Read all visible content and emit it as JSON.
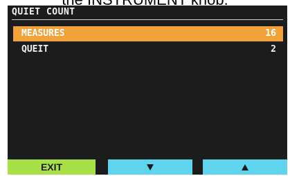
{
  "caption": "the INSTRUMENT knob.",
  "screen": {
    "title": "QUIET COUNT",
    "items": [
      {
        "label": "MEASURES",
        "value": "16",
        "selected": true
      },
      {
        "label": "QUEIT",
        "value": "2",
        "selected": false
      }
    ]
  },
  "softkeys": {
    "exit_label": "EXIT",
    "down_icon": "down-triangle-icon",
    "up_icon": "up-triangle-icon"
  },
  "colors": {
    "screen_background": "#1c1c1c",
    "selection": "#f2a23a",
    "exit_key": "#a8e048",
    "arrow_keys": "#5ed4ee"
  }
}
